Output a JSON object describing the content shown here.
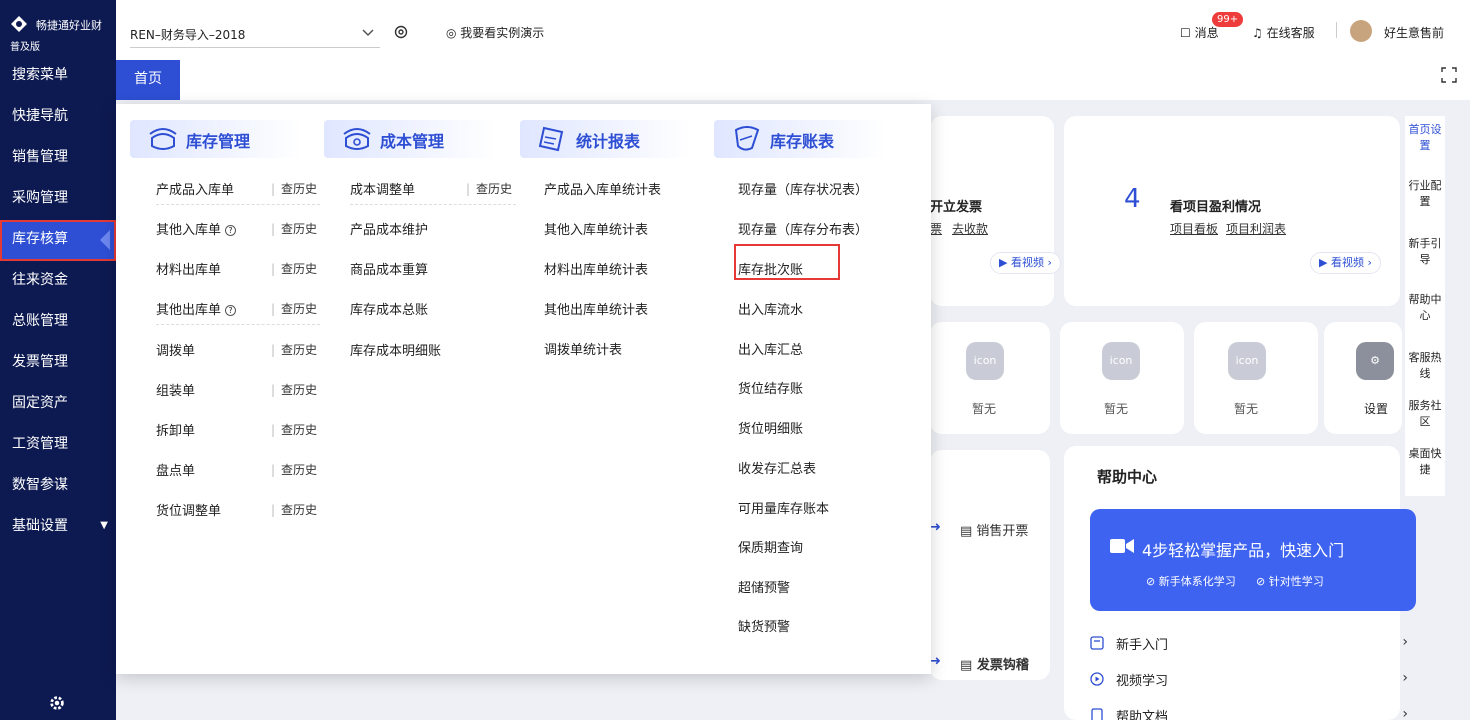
{
  "sidebar": {
    "brand": "畅捷通好业财",
    "edition": "普及版",
    "items": [
      {
        "label": "搜索菜单"
      },
      {
        "label": "快捷导航"
      },
      {
        "label": "销售管理"
      },
      {
        "label": "采购管理"
      },
      {
        "label": "库存核算",
        "active": true
      },
      {
        "label": "往来资金"
      },
      {
        "label": "总账管理"
      },
      {
        "label": "发票管理"
      },
      {
        "label": "固定资产"
      },
      {
        "label": "工资管理"
      },
      {
        "label": "数智参谋"
      },
      {
        "label": "基础设置",
        "has_caret": true
      }
    ]
  },
  "header": {
    "account": "REN–财务导入–2018",
    "demo_label": "我要看实例演示",
    "messages_label": "消息",
    "messages_badge": "99+",
    "service_label": "在线客服",
    "user_name": "好生意售前"
  },
  "tabs": [
    {
      "label": "首页",
      "active": true
    }
  ],
  "colors": {
    "sidebar_bg": "#0d1a52",
    "accent": "#2e4fd4",
    "highlight_red": "#e53935",
    "badge_red": "#ee3b3b"
  },
  "menu": {
    "columns": [
      {
        "title": "库存管理",
        "icon": "inventory-icon",
        "items": [
          {
            "label": "产成品入库单",
            "history": "查历史"
          },
          {
            "label": "其他入库单",
            "history": "查历史",
            "help": true
          },
          {
            "label": "材料出库单",
            "history": "查历史"
          },
          {
            "label": "其他出库单",
            "history": "查历史",
            "help": true
          },
          {
            "label": "调拨单",
            "history": "查历史"
          },
          {
            "label": "组装单",
            "history": "查历史"
          },
          {
            "label": "拆卸单",
            "history": "查历史"
          },
          {
            "label": "盘点单",
            "history": "查历史"
          },
          {
            "label": "货位调整单",
            "history": "查历史"
          }
        ]
      },
      {
        "title": "成本管理",
        "icon": "cost-icon",
        "items": [
          {
            "label": "成本调整单",
            "history": "查历史"
          },
          {
            "label": "产品成本维护"
          },
          {
            "label": "商品成本重算"
          },
          {
            "label": "库存成本总账"
          },
          {
            "label": "库存成本明细账"
          }
        ]
      },
      {
        "title": "统计报表",
        "icon": "report-icon",
        "items": [
          {
            "label": "产成品入库单统计表"
          },
          {
            "label": "其他入库单统计表"
          },
          {
            "label": "材料出库单统计表"
          },
          {
            "label": "其他出库单统计表"
          },
          {
            "label": "调拨单统计表"
          }
        ]
      },
      {
        "title": "库存账表",
        "icon": "ledger-icon",
        "items": [
          {
            "label": "现存量（库存状况表）"
          },
          {
            "label": "现存量（库存分布表）"
          },
          {
            "label": "库存批次账",
            "highlighted": true
          },
          {
            "label": "出入库流水"
          },
          {
            "label": "出入库汇总"
          },
          {
            "label": "货位结存账"
          },
          {
            "label": "货位明细账"
          },
          {
            "label": "收发存汇总表"
          },
          {
            "label": "可用量库存账本"
          },
          {
            "label": "保质期查询"
          },
          {
            "label": "超储预警"
          },
          {
            "label": "缺货预警"
          }
        ]
      }
    ]
  },
  "background": {
    "step3_title_partial": "开立发票",
    "step3_links_partial": [
      "票",
      "去收款"
    ],
    "step4_num": "4",
    "step4_title": "看项目盈利情况",
    "step4_links": [
      "项目看板",
      "项目利润表"
    ],
    "video_label": "看视频",
    "icon_tiles": [
      {
        "icon_text": "icon",
        "label": "暂无"
      },
      {
        "icon_text": "icon",
        "label": "暂无"
      },
      {
        "icon_text": "icon",
        "label": "暂无"
      }
    ],
    "settings_label": "设置",
    "flow_sales_invoice": "销售开票",
    "flow_invoice_check": "发票钩稽",
    "help_center": {
      "title": "帮助中心",
      "banner_main": "4步轻松掌握产品，快速入门",
      "banner_sub1": "新手体系化学习",
      "banner_sub2": "针对性学习",
      "links": [
        "新手入门",
        "视频学习",
        "帮助文档"
      ]
    }
  },
  "right_rail": [
    {
      "label": "首页设置",
      "blue": true
    },
    {
      "label": "行业配置"
    },
    {
      "label": "新手引导"
    },
    {
      "label": "帮助中心"
    },
    {
      "label": "客服热线"
    },
    {
      "label": "服务社区"
    },
    {
      "label": "桌面快捷"
    }
  ]
}
